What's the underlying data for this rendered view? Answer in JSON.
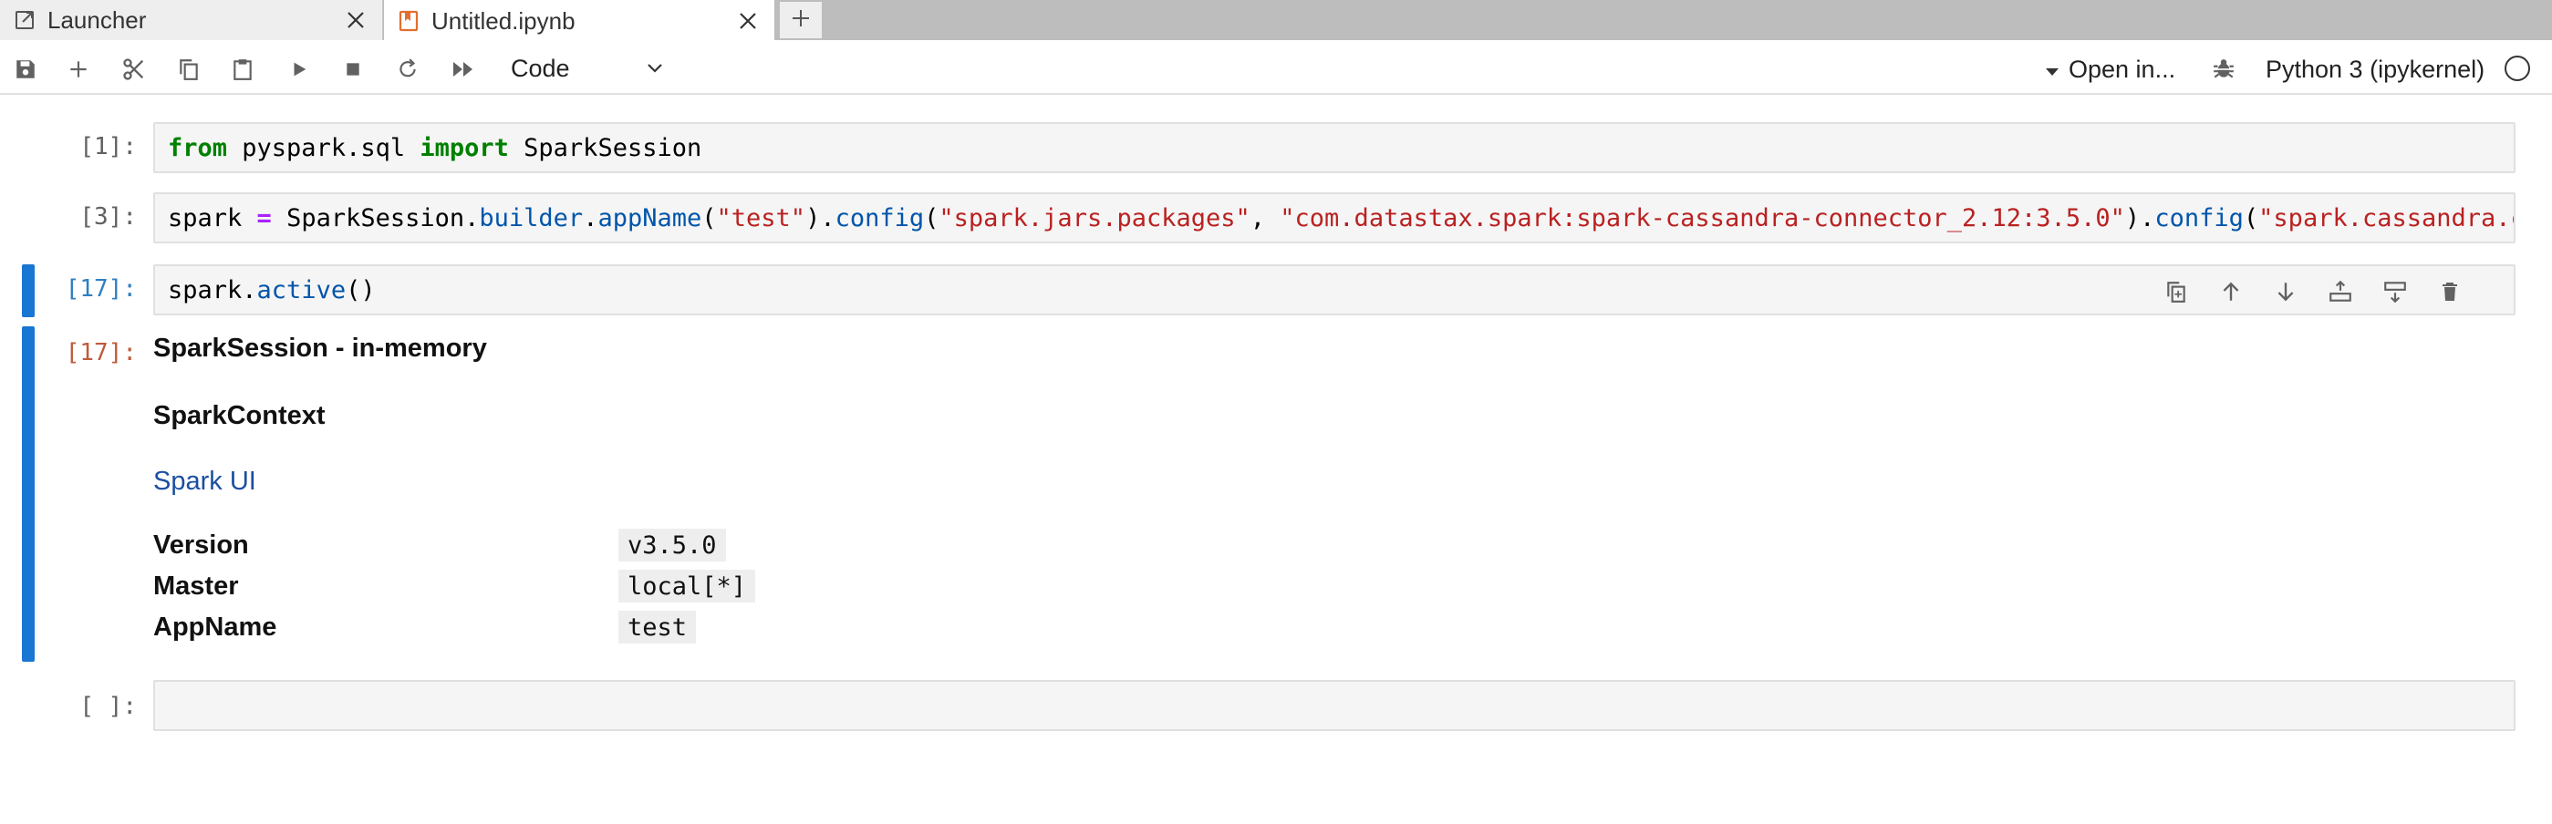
{
  "tabs": [
    {
      "label": "Launcher",
      "icon": "launcher-icon"
    },
    {
      "label": "Untitled.ipynb",
      "icon": "notebook-icon"
    }
  ],
  "toolbar": {
    "cell_type": "Code",
    "open_in": "Open in...",
    "kernel_name": "Python 3 (ipykernel)",
    "icons": [
      "save-icon",
      "add-cell-icon",
      "cut-icon",
      "copy-icon",
      "paste-icon",
      "run-icon",
      "stop-icon",
      "restart-icon",
      "fast-forward-icon"
    ]
  },
  "cells": [
    {
      "prompt": "[1]:",
      "code": [
        "from",
        " pyspark.sql ",
        "import",
        " SparkSession"
      ]
    },
    {
      "prompt": "[3]:",
      "code": [
        "spark ",
        "=",
        " SparkSession.",
        "builder",
        ".",
        "appName",
        "(",
        "\"test\"",
        ").",
        "config",
        "(",
        "\"spark.jars.packages\"",
        ", ",
        "\"com.datastax.spark:spark-cassandra-connector_2.12:3.5.0\"",
        ").",
        "config",
        "(",
        "\"spark.cassandra.connect"
      ]
    },
    {
      "prompt": "[17]:",
      "code": [
        "spark.",
        "active",
        "()"
      ]
    },
    {
      "prompt": "[ ]:",
      "code": []
    }
  ],
  "output": {
    "prompt": "[17]:",
    "title": "SparkSession - in-memory",
    "subtitle": "SparkContext",
    "link": "Spark UI",
    "rows": [
      {
        "key": "Version",
        "value": "v3.5.0"
      },
      {
        "key": "Master",
        "value": "local[*]"
      },
      {
        "key": "AppName",
        "value": "test"
      }
    ]
  },
  "colors": {
    "accent": "#1976d2",
    "keyword": "#008000",
    "string": "#ba2121",
    "attribute": "#0055aa",
    "output_prompt": "#bf5b3d"
  }
}
